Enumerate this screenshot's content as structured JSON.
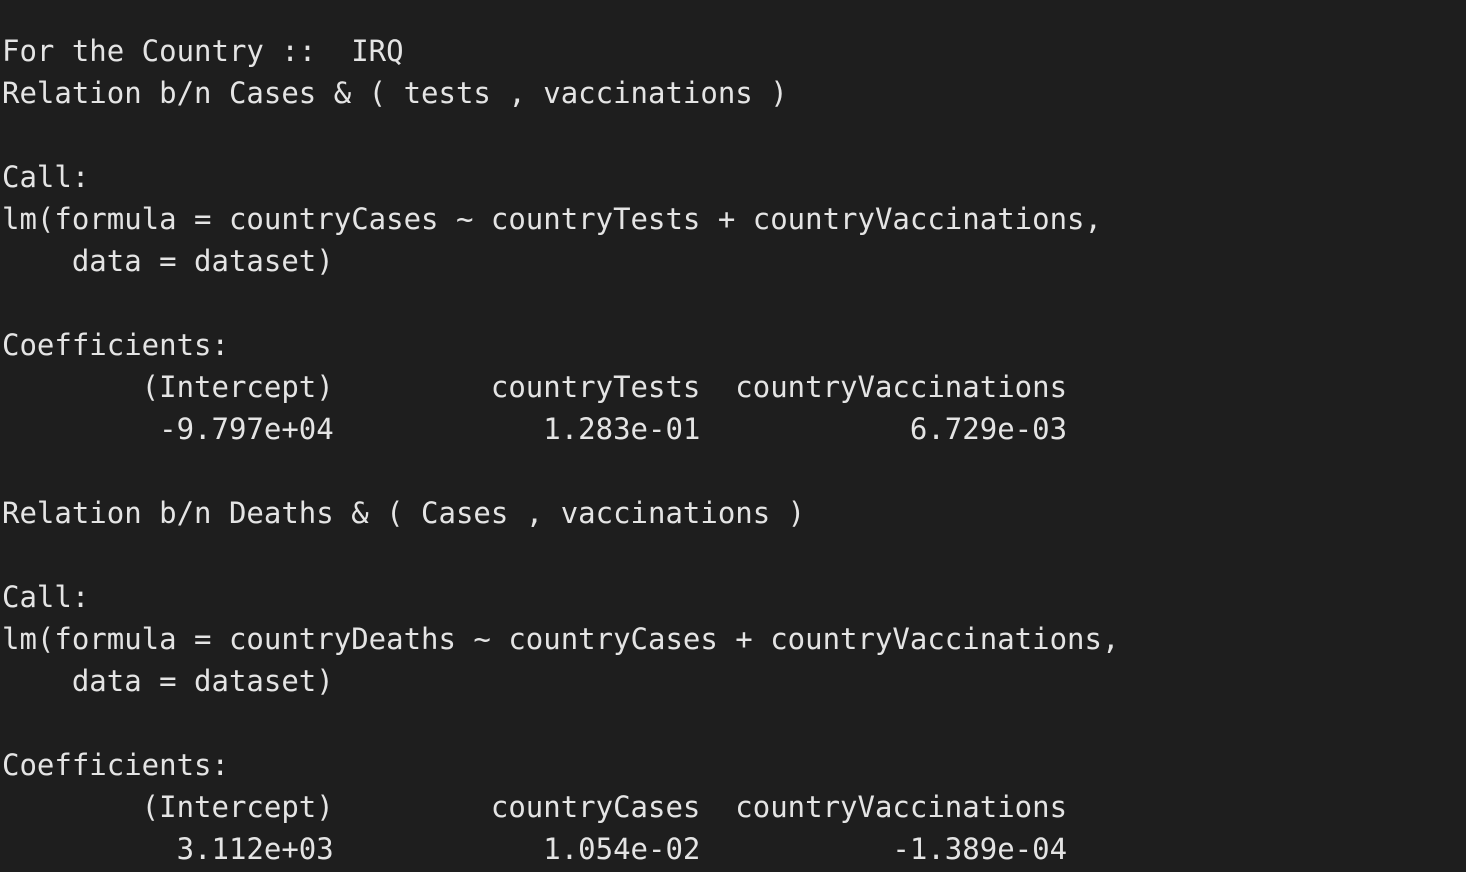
{
  "terminal": {
    "lines": [
      "For the Country ::  IRQ",
      "Relation b/n Cases & ( tests , vaccinations )",
      "",
      "Call:",
      "lm(formula = countryCases ~ countryTests + countryVaccinations,",
      "    data = dataset)",
      "",
      "Coefficients:",
      "        (Intercept)         countryTests  countryVaccinations",
      "         -9.797e+04            1.283e-01            6.729e-03",
      "",
      "Relation b/n Deaths & ( Cases , vaccinations )",
      "",
      "Call:",
      "lm(formula = countryDeaths ~ countryCases + countryVaccinations,",
      "    data = dataset)",
      "",
      "Coefficients:",
      "        (Intercept)         countryCases  countryVaccinations",
      "          3.112e+03            1.054e-02           -1.389e-04"
    ]
  },
  "colors": {
    "background": "#1e1e1e",
    "foreground": "#e4e4e4"
  }
}
